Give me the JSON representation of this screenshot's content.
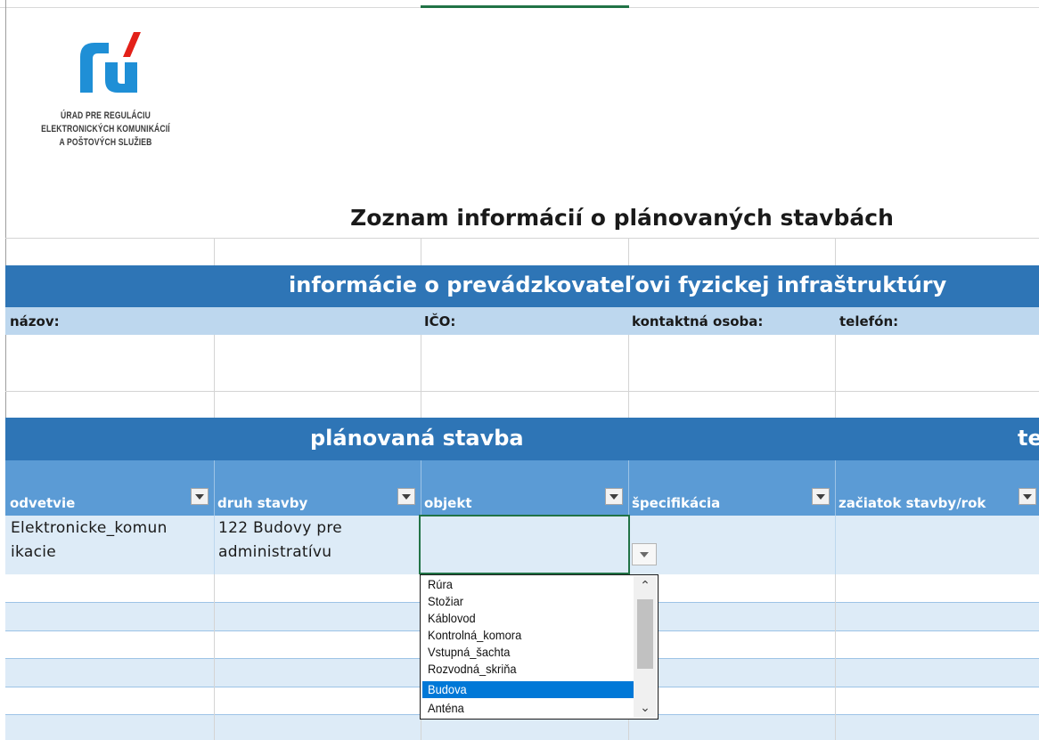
{
  "logo": {
    "line1": "ÚRAD PRE REGULÁCIU",
    "line2": "ELEKTRONICKÝCH KOMUNIKÁCIÍ",
    "line3": "A POŠTOVÝCH SLUŽIEB"
  },
  "title": "Zoznam informácií o plánovaných stavbách",
  "operator_section": {
    "header": "informácie o prevádzkovateľovi fyzickej infraštruktúry",
    "fields": {
      "name": "názov:",
      "ico": "IČO:",
      "contact": "kontaktná osoba:",
      "phone": "telefón:"
    }
  },
  "planned_section": {
    "header": "plánovaná stavba",
    "next_header_fragment": "te"
  },
  "columns": [
    "odvetvie",
    "druh stavby",
    "objekt",
    "špecifikácia",
    "začiatok stavby/rok"
  ],
  "row1": {
    "odvetvie_line1": "Elektronicke_komun",
    "odvetvie_line2": "ikacie",
    "druh_line1": "122 Budovy pre",
    "druh_line2": "administratívu"
  },
  "dropdown": {
    "options": [
      "Rúra",
      "Stožiar",
      "Káblovod",
      "Kontrolná_komora",
      "Vstupná_šachta",
      "Rozvodná_skriňa",
      "Budova",
      "Anténa"
    ],
    "selected": "Budova"
  },
  "colors": {
    "header_dark": "#2e75b6",
    "header_light": "#bdd7ee",
    "column_header": "#5b9bd5",
    "row_pale": "#ddebf7",
    "logo_blue": "#1f8fd6",
    "logo_red": "#e32119",
    "selection": "#0078d7"
  }
}
